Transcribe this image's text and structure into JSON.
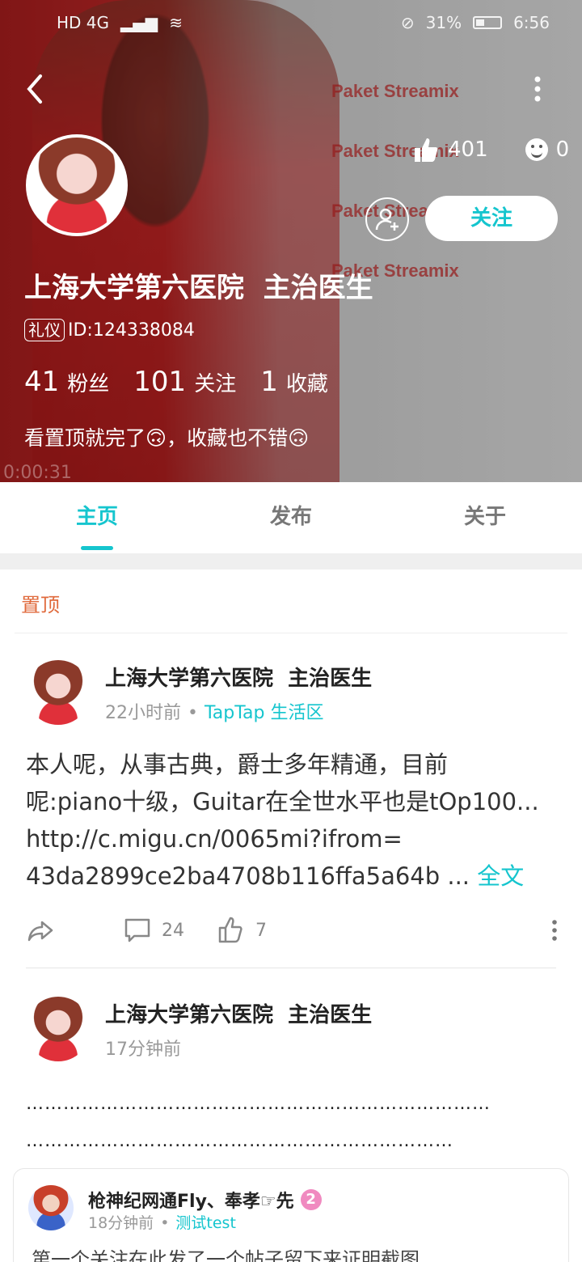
{
  "status_bar": {
    "left_icons": "HD 4G",
    "battery_percent": "31%",
    "time": "6:56"
  },
  "header": {
    "back_icon": "back-arrow-icon",
    "more_icon": "more-vertical-icon",
    "likes_count": "401",
    "emoji_count": "0",
    "follow_label": "关注",
    "profile_name": "上海大学第六医院  主治医生",
    "badge": "礼仪",
    "id_text": "ID:124338084",
    "followers_num": "41",
    "followers_label": "粉丝",
    "following_num": "101",
    "following_label": "关注",
    "favorites_num": "1",
    "favorites_label": "收藏",
    "bio": "看置顶就完了🙃，收藏也不错🙃",
    "video_timer": "0:00:31",
    "ad_lines": [
      "Paket Streamix",
      "Paket Streamix",
      "Paket Streamix",
      "Paket Streamix"
    ]
  },
  "tabs": [
    {
      "label": "主页",
      "active": true
    },
    {
      "label": "发布",
      "active": false
    },
    {
      "label": "关于",
      "active": false
    }
  ],
  "pinned_label": "置顶",
  "post1": {
    "author": "上海大学第六医院  主治医生",
    "time": "22小时前",
    "forum": "TapTap 生活区",
    "lines": [
      "本人呢，从事古典，爵士多年精通，目前",
      "呢:piano十级，Guitar在全世水平也是tOp100...",
      "http://c.migu.cn/0065mi?ifrom=",
      "43da2899ce2ba4708b116ffa5a64b ..."
    ],
    "read_more": "全文",
    "comments": "24",
    "likes": "7"
  },
  "post2": {
    "author": "上海大学第六医院  主治医生",
    "time": "17分钟前",
    "dots1": "…………………………………………………………………",
    "dots2": "……………………………………………………………"
  },
  "quoted": {
    "author": "枪神纪网通Fly、奉孝☞先",
    "level": "2",
    "time": "18分钟前",
    "forum": "测试test",
    "text": "第一个关注在此发了一个帖子留下来证明截图"
  },
  "colors": {
    "accent": "#15c5ce",
    "pinned": "#e06a3c"
  }
}
